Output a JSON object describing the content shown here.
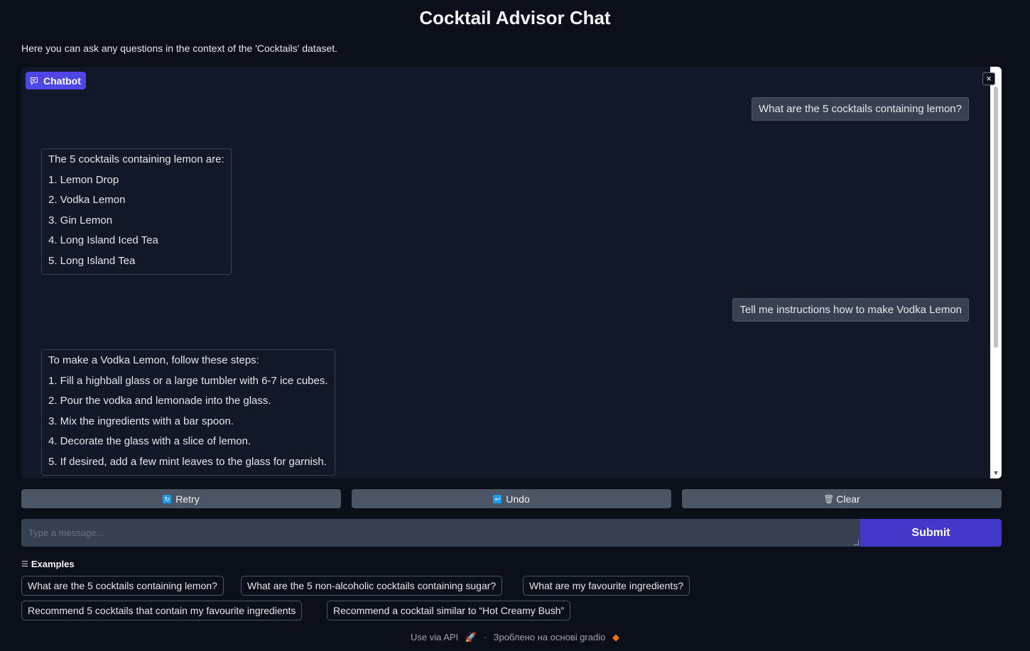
{
  "page": {
    "title": "Cocktail Advisor Chat",
    "description": "Here you can ask any questions in the context of the 'Cocktails' dataset."
  },
  "chatbot": {
    "label": "Chatbot",
    "label_icon": "chat-bubble-icon",
    "close_icon": "close-icon",
    "close_glyph": "×",
    "messages": [
      {
        "role": "user",
        "text": "What are the 5 cocktails containing lemon?"
      },
      {
        "role": "bot",
        "lines": [
          "The 5 cocktails containing lemon are:",
          "1. Lemon Drop",
          "2. Vodka Lemon",
          "3. Gin Lemon",
          "4. Long Island Iced Tea",
          "5. Long Island Tea"
        ]
      },
      {
        "role": "user",
        "text": "Tell me instructions how to make Vodka Lemon"
      },
      {
        "role": "bot",
        "lines": [
          "To make a Vodka Lemon, follow these steps:",
          "1. Fill a highball glass or a large tumbler with 6-7 ice cubes.",
          "2. Pour the vodka and lemonade into the glass.",
          "3. Mix the ingredients with a bar spoon.",
          "4. Decorate the glass with a slice of lemon.",
          "5. If desired, add a few mint leaves to the glass for garnish."
        ]
      }
    ]
  },
  "actions": {
    "retry": {
      "label": "Retry",
      "icon": "retry-icon"
    },
    "undo": {
      "label": "Undo",
      "icon": "undo-icon"
    },
    "clear": {
      "label": "Clear",
      "icon": "trash-icon"
    }
  },
  "composer": {
    "placeholder": "Type a message...",
    "value": "",
    "submit_label": "Submit"
  },
  "examples": {
    "label": "Examples",
    "items": [
      "What are the 5 cocktails containing lemon?",
      "What are the 5 non-alcoholic cocktails containing sugar?",
      "What are my favourite ingredients?",
      "Recommend 5 cocktails that contain my favourite ingredients",
      "Recommend a cocktail similar to “Hot Creamy Bush”"
    ]
  },
  "footer": {
    "api_label": "Use via API",
    "separator": "·",
    "built_with": "Зроблено на основі gradio"
  },
  "colors": {
    "background": "#0b0f19",
    "accent": "#4f46e5",
    "submit": "#4338ca"
  }
}
